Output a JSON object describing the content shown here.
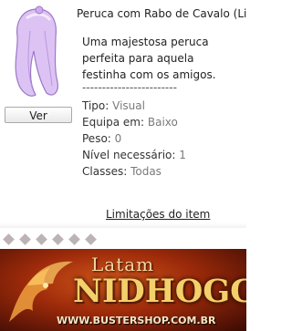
{
  "item": {
    "title": "Peruca com Rabo de Cavalo (Lil",
    "view_button": "Ver",
    "description": [
      "Uma majestosa peruca",
      "perfeita para aquela",
      "festinha com os amigos."
    ],
    "separator": "------------------------",
    "properties": [
      {
        "key": "Tipo: ",
        "value": "Visual"
      },
      {
        "key": "Equipa em: ",
        "value": "Baixo"
      },
      {
        "key": "Peso: ",
        "value": "0"
      },
      {
        "key": "Nível necessário: ",
        "value": "1"
      },
      {
        "key": "Classes: ",
        "value": "Todas"
      }
    ],
    "limits_link": "Limitações do item"
  },
  "banner": {
    "top_text": "Latam",
    "main_text": "NIDHOGG",
    "url_text": "WWW.BUSTERSHOP.COM.BR"
  },
  "colors": {
    "hair": "#d6b8f0",
    "banner": "#9c2a0a",
    "gold": "#f4d06a"
  }
}
